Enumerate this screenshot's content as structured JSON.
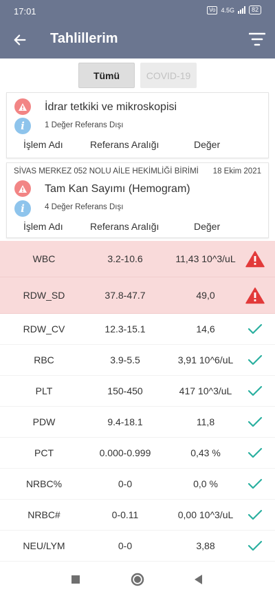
{
  "status_bar": {
    "time": "17:01",
    "network_label": "4.5G",
    "sim_badge": "Vo",
    "battery": "82"
  },
  "app_bar": {
    "title": "Tahlillerim",
    "back_icon": "arrow-left-icon",
    "filter_icon": "filter-lines-icon"
  },
  "segments": [
    {
      "label": "Tümü",
      "selected": true
    },
    {
      "label": "COVID-19",
      "selected": false
    }
  ],
  "cards": [
    {
      "institution": "",
      "date": "",
      "title": "İdrar tetkiki ve mikroskopisi",
      "subtitle": "1 Değer Referans Dışı",
      "columns": [
        "İşlem Adı",
        "Referans Aralığı",
        "Değer"
      ]
    },
    {
      "institution": "SİVAS MERKEZ 052 NOLU AİLE HEKİMLİĞİ BİRİMİ",
      "date": "18 Ekim 2021",
      "title": "Tam Kan Sayımı (Hemogram)",
      "subtitle": "4 Değer Referans Dışı",
      "columns": [
        "İşlem Adı",
        "Referans Aralığı",
        "Değer"
      ]
    }
  ],
  "results": [
    {
      "name": "WBC",
      "range": "3.2-10.6",
      "value": "11,43 10^3/uL",
      "status": "warning"
    },
    {
      "name": "RDW_SD",
      "range": "37.8-47.7",
      "value": "49,0",
      "status": "warning"
    },
    {
      "name": "RDW_CV",
      "range": "12.3-15.1",
      "value": "14,6",
      "status": "ok"
    },
    {
      "name": "RBC",
      "range": "3.9-5.5",
      "value": "3,91 10^6/uL",
      "status": "ok"
    },
    {
      "name": "PLT",
      "range": "150-450",
      "value": "417 10^3/uL",
      "status": "ok"
    },
    {
      "name": "PDW",
      "range": "9.4-18.1",
      "value": "11,8",
      "status": "ok"
    },
    {
      "name": "PCT",
      "range": "0.000-0.999",
      "value": "0,43 %",
      "status": "ok"
    },
    {
      "name": "NRBC%",
      "range": "0-0",
      "value": "0,0 %",
      "status": "ok"
    },
    {
      "name": "NRBC#",
      "range": "0-0.11",
      "value": "0,00 10^3/uL",
      "status": "ok"
    },
    {
      "name": "NEU/LYM",
      "range": "0-0",
      "value": "3,88",
      "status": "ok"
    }
  ],
  "nav": {
    "recents_icon": "square-icon",
    "home_icon": "circle-icon",
    "back_icon": "triangle-back-icon"
  },
  "colors": {
    "app_bar": "#6b7690",
    "flag_row": "#f9dada",
    "warning_red": "#e23a3a",
    "ok_teal": "#2bb0a0",
    "info_blue": "#8ec4ec",
    "warn_badge": "#f28585"
  }
}
